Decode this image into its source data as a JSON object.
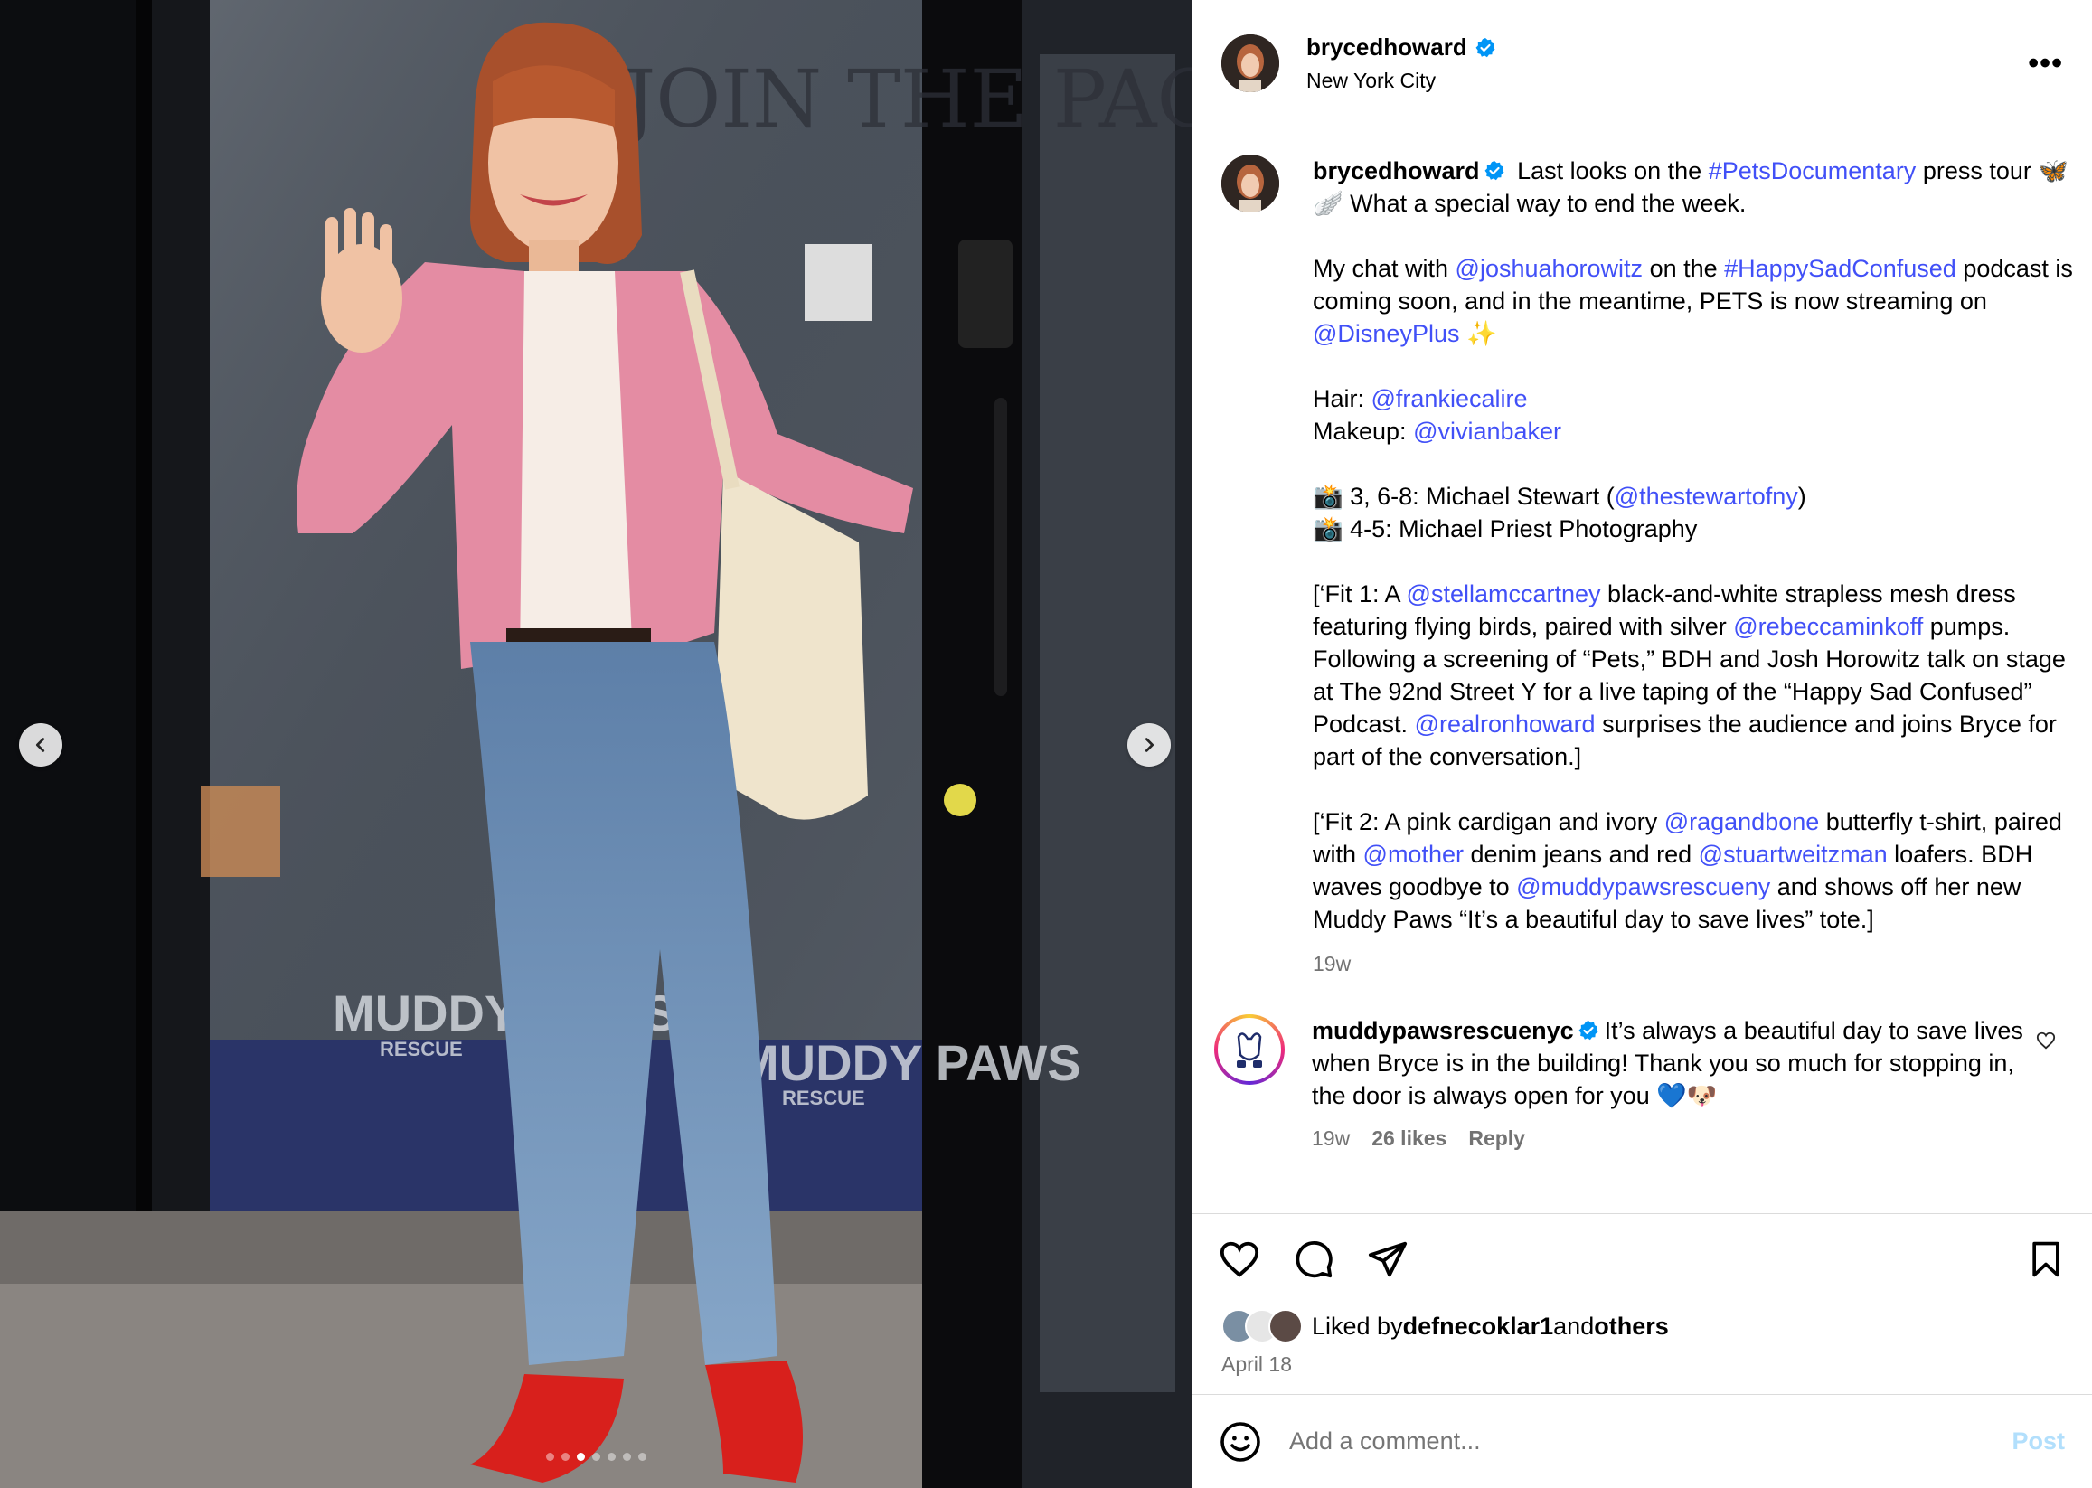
{
  "post": {
    "username": "brycedhoward",
    "location": "New York City",
    "more_label": "•••"
  },
  "caption_parts": [
    {
      "t": "Last looks on the ",
      "k": "text"
    },
    {
      "t": "#PetsDocumentary",
      "k": "link"
    },
    {
      "t": " press tour 🦋🪽 What a special way to end the week.\n\nMy chat with ",
      "k": "text"
    },
    {
      "t": "@joshuahorowitz",
      "k": "link"
    },
    {
      "t": " on the ",
      "k": "text"
    },
    {
      "t": "#HappySadConfused",
      "k": "link"
    },
    {
      "t": " podcast is coming soon, and in the meantime, PETS is now streaming on ",
      "k": "text"
    },
    {
      "t": "@DisneyPlus",
      "k": "link"
    },
    {
      "t": " ✨\n\nHair: ",
      "k": "text"
    },
    {
      "t": "@frankiecalire",
      "k": "link"
    },
    {
      "t": "\nMakeup: ",
      "k": "text"
    },
    {
      "t": "@vivianbaker",
      "k": "link"
    },
    {
      "t": "\n\n📸 3, 6-8: Michael Stewart (",
      "k": "text"
    },
    {
      "t": "@thestewartofny",
      "k": "link"
    },
    {
      "t": ")\n📸 4-5: Michael Priest Photography\n\n[‘Fit 1: A ",
      "k": "text"
    },
    {
      "t": "@stellamccartney",
      "k": "link"
    },
    {
      "t": " black-and-white strapless mesh dress featuring flying birds, paired with silver ",
      "k": "text"
    },
    {
      "t": "@rebeccaminkoff",
      "k": "link"
    },
    {
      "t": " pumps. Following a screening of “Pets,” BDH and Josh Horowitz talk on stage at The 92nd Street Y for a live taping of the “Happy Sad Confused” Podcast. ",
      "k": "text"
    },
    {
      "t": "@realronhoward",
      "k": "link"
    },
    {
      "t": " surprises the audience and joins Bryce for part of the conversation.]\n\n[‘Fit 2: A pink cardigan and ivory ",
      "k": "text"
    },
    {
      "t": "@ragandbone",
      "k": "link"
    },
    {
      "t": " butterfly t-shirt, paired with ",
      "k": "text"
    },
    {
      "t": "@mother",
      "k": "link"
    },
    {
      "t": " denim jeans and red ",
      "k": "text"
    },
    {
      "t": "@stuartweitzman",
      "k": "link"
    },
    {
      "t": " loafers. BDH waves goodbye to ",
      "k": "text"
    },
    {
      "t": "@muddypawsrescueny",
      "k": "link"
    },
    {
      "t": " and shows off her new Muddy Paws “It’s a beautiful day to save lives” tote.]",
      "k": "text"
    }
  ],
  "caption_time": "19w",
  "comment": {
    "username": "muddypawsrescuenyc",
    "text": "It’s always a beautiful day to save lives when Bryce is in the building! Thank you so much for stopping in, the door is always open for you 💙🐶",
    "time": "19w",
    "likes": "26 likes",
    "reply_label": "Reply"
  },
  "likes": {
    "prefix": "Liked by ",
    "user": "defnecoklar1",
    "middle": " and ",
    "others": "others"
  },
  "date": "April 18",
  "add_comment": {
    "placeholder": "Add a comment...",
    "post_label": "Post"
  },
  "carousel": {
    "dot_count": 7,
    "active_index": 2
  },
  "photo_text": {
    "window_top": "JOIN THE PACK",
    "logo_left": "MUDDY PAWS",
    "logo_left_sub": "RESCUE",
    "logo_right": "MUDDY PAWS",
    "logo_right_sub": "RESCUE"
  },
  "icons": {
    "verified": "verified-badge-icon",
    "like": "heart-icon",
    "comment": "comment-bubble-icon",
    "share": "paper-plane-icon",
    "save": "bookmark-icon",
    "emoji": "smiley-icon",
    "prev": "chevron-left-icon",
    "next": "chevron-right-icon"
  },
  "colors": {
    "link": "#4150f7",
    "verified": "#0095f6",
    "muted": "#737373",
    "post_disabled": "#b2dffc"
  }
}
